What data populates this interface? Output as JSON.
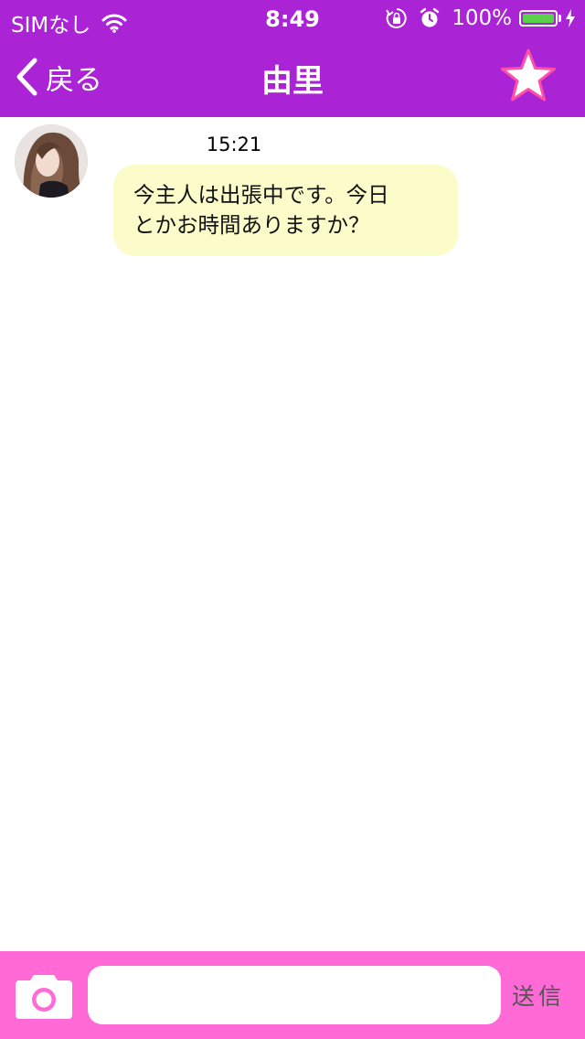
{
  "status_bar": {
    "carrier": "SIMなし",
    "time": "8:49",
    "battery_percent": "100%",
    "icons": [
      "wifi-icon",
      "orientation-lock-icon",
      "alarm-icon",
      "battery-icon",
      "charging-bolt-icon"
    ]
  },
  "nav": {
    "back_label": "戻る",
    "title": "由里",
    "favorite_icon": "star-icon"
  },
  "chat": {
    "messages": [
      {
        "time": "15:21",
        "lines": [
          "今主人は出張中です。今日",
          "とかお時間ありますか？"
        ],
        "sender_avatar": "avatar-photo"
      }
    ]
  },
  "composer": {
    "camera_icon": "camera-icon",
    "input_value": "",
    "input_placeholder": "",
    "send_label": "送信"
  },
  "colors": {
    "header_bg": "#aa24d6",
    "bottom_bar_bg": "#ff6ad6",
    "bubble_bg": "#fbfcc9",
    "star_fill": "#ffffff",
    "star_stroke": "#ff4fa6",
    "battery_fill": "#5ad04b"
  }
}
